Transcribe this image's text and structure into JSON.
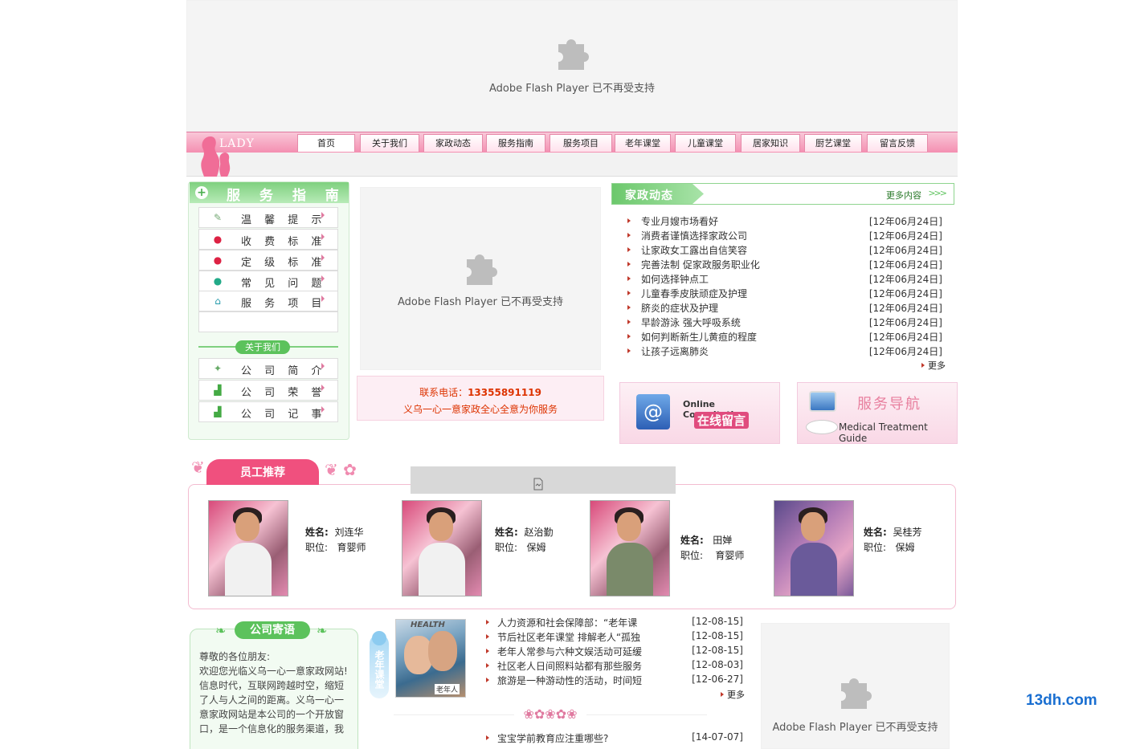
{
  "flash_message": "Adobe Flash Player 已不再受支持",
  "brand": {
    "logo_text": "LADY"
  },
  "nav": [
    "首页",
    "关于我们",
    "家政动态",
    "服务指南",
    "服务项目",
    "老年课堂",
    "儿童课堂",
    "居家知识",
    "厨艺课堂",
    "留言反馈"
  ],
  "service_guide": {
    "title": "服 务 指 南",
    "items": [
      "温 馨 提 示",
      "收 费 标 准",
      "定 级 标 准",
      "常 见 问 题",
      "服 务 项 目"
    ]
  },
  "about_us": {
    "title": "关于我们",
    "items": [
      "公 司 简 介",
      "公 司 荣 誉",
      "公 司 记 事"
    ]
  },
  "contact": {
    "phone_label": "联系电话：",
    "phone": "13355891119",
    "slogan": "义乌一心一意家政全心全意为你服务"
  },
  "news": {
    "title": "家政动态",
    "more_link": "更多内容",
    "items": [
      {
        "title": "专业月嫂市场看好",
        "date": "[12年06月24日]"
      },
      {
        "title": "消费者谨慎选择家政公司",
        "date": "[12年06月24日]"
      },
      {
        "title": "让家政女工露出自信笑容",
        "date": "[12年06月24日]"
      },
      {
        "title": "完善法制 促家政服务职业化",
        "date": "[12年06月24日]"
      },
      {
        "title": "如何选择钟点工",
        "date": "[12年06月24日]"
      },
      {
        "title": "儿童春季皮肤顽症及护理",
        "date": "[12年06月24日]"
      },
      {
        "title": "脐炎的症状及护理",
        "date": "[12年06月24日]"
      },
      {
        "title": "早龄游泳 强大呼吸系统",
        "date": "[12年06月24日]"
      },
      {
        "title": "如何判断新生儿黄疸的程度",
        "date": "[12年06月24日]"
      },
      {
        "title": "让孩子远离肺炎",
        "date": "[12年06月24日]"
      }
    ],
    "more": "更多"
  },
  "banners": {
    "online": {
      "en": "Online Consultation",
      "cn": "在线留言"
    },
    "guide": {
      "cn": "服务导航",
      "en": "Medical Treatment Guide"
    }
  },
  "employees": {
    "title": "员工推荐",
    "name_label": "姓名:",
    "role_label": "职位:",
    "list": [
      {
        "name": "刘连华",
        "role": "育婴师"
      },
      {
        "name": "赵治勤",
        "role": "保姆"
      },
      {
        "name": "田婵",
        "role": "育婴师"
      },
      {
        "name": "吴桂芳",
        "role": "保姆"
      }
    ]
  },
  "greeting": {
    "title": "公司寄语",
    "text": "尊敬的各位朋友:\n欢迎您光临义乌一心一意家政网站!\n信息时代，互联网跨越时空，缩短了人与人之间的距离。义乌一心一意家政网站是本公司的一个开放窗口，是一个信息化的服务渠道，我"
  },
  "elder_class": {
    "tag": "老年课堂",
    "image_header": "HEALTH",
    "image_label": "老年人",
    "items": [
      {
        "title": "人力资源和社会保障部：“老年课",
        "date": "[12-08-15]"
      },
      {
        "title": "节后社区老年课堂 排解老人“孤独",
        "date": "[12-08-15]"
      },
      {
        "title": "老年人常参与六种文娱活动可延缓",
        "date": "[12-08-15]"
      },
      {
        "title": "社区老人日间照料站都有那些服务",
        "date": "[12-08-03]"
      },
      {
        "title": "旅游是一种游动性的活动，时间短",
        "date": "[12-06-27]"
      }
    ],
    "more": "更多"
  },
  "child_class": {
    "items": [
      {
        "title": "宝宝学前教育应注重哪些?",
        "date": "[14-07-07]"
      }
    ]
  },
  "watermark": "13dh.com",
  "colors": {
    "pink": "#f48fb1",
    "green": "#5cc25c",
    "red": "#d30000",
    "blue": "#1a6fd1"
  }
}
